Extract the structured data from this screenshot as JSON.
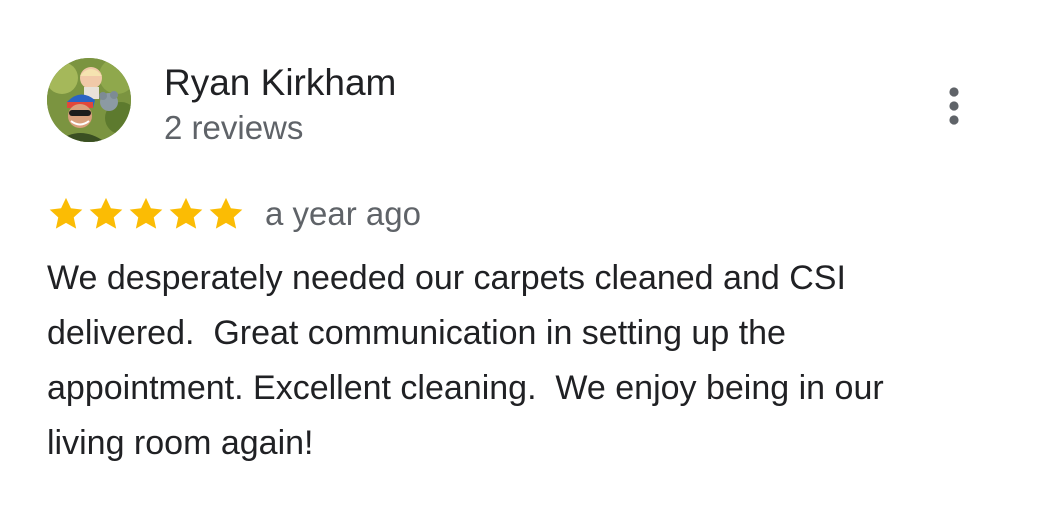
{
  "review": {
    "reviewer_name": "Ryan Kirkham",
    "review_count": "2 reviews",
    "rating": 5,
    "rating_max": 5,
    "star_color": "#fbbc04",
    "date": "a year ago",
    "text": "We desperately needed our carpets cleaned and CSI\ndelivered.  Great communication in setting up the\nappointment. Excellent cleaning.  We enjoy being in our\nliving room again!",
    "more_icon": "more-vert-icon",
    "avatar_icon": "user-photo"
  }
}
